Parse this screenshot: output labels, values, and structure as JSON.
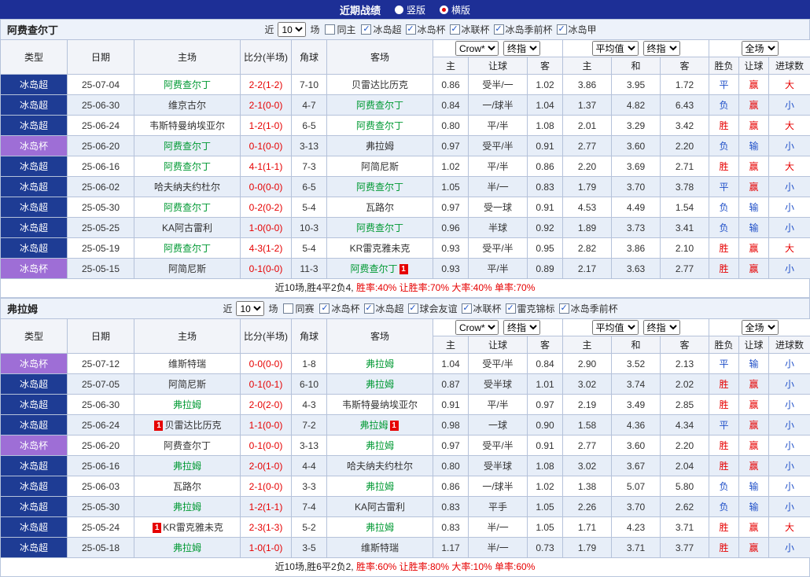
{
  "topbar": {
    "title": "近期战绩",
    "vertical_label": "竖版",
    "horizontal_label": "横版",
    "selected": "横版"
  },
  "labels": {
    "near": "近",
    "games": "场"
  },
  "badge_label": "1",
  "checkmark": "✓",
  "table_headers": [
    "类型",
    "日期",
    "主场",
    "比分(半场)",
    "角球",
    "客场",
    "主",
    "让球",
    "客",
    "主",
    "和",
    "客",
    "胜负",
    "让球",
    "进球数"
  ],
  "group_dropdowns": [
    [
      "Crow*",
      "终指"
    ],
    [
      "平均值",
      "终指"
    ],
    [
      "全场"
    ]
  ],
  "colors": {
    "topbar_bg": "#1d2f96",
    "league_super_bg": "#1e3c94",
    "league_cup_bg": "#9e6ed6",
    "focus_green": "#009933",
    "score_red": "#e60000",
    "win_red": "#e60000",
    "lose_blue": "#2050c8",
    "alt_row_bg": "#e7eef8",
    "badge_red": "#e60000"
  },
  "sections": [
    {
      "team": "阿费查尔丁",
      "count": "10",
      "same_label": "同主",
      "leagues": [
        "冰岛超",
        "冰岛杯",
        "冰联杯",
        "冰岛季前杯",
        "冰岛甲"
      ],
      "rows": [
        {
          "league": "冰岛超",
          "date": "25-07-04",
          "home": "阿费查尔丁",
          "home_focus": true,
          "score": "2-2(1-2)",
          "corners": "7-10",
          "away": "贝雷达比历克",
          "away_focus": false,
          "odds_home": "0.86",
          "handicap": "受半/一",
          "odds_away": "1.02",
          "avg_home": "3.86",
          "avg_draw": "3.95",
          "avg_away": "1.72",
          "result": "平",
          "handicap_result": "赢",
          "goals": "大"
        },
        {
          "league": "冰岛超",
          "date": "25-06-30",
          "home": "维京古尔",
          "home_focus": false,
          "score": "2-1(0-0)",
          "corners": "4-7",
          "away": "阿费查尔丁",
          "away_focus": true,
          "odds_home": "0.84",
          "handicap": "一/球半",
          "odds_away": "1.04",
          "avg_home": "1.37",
          "avg_draw": "4.82",
          "avg_away": "6.43",
          "result": "负",
          "handicap_result": "赢",
          "goals": "小"
        },
        {
          "league": "冰岛超",
          "date": "25-06-24",
          "home": "韦斯特曼纳埃亚尔",
          "home_focus": false,
          "score": "1-2(1-0)",
          "corners": "6-5",
          "away": "阿费查尔丁",
          "away_focus": true,
          "odds_home": "0.80",
          "handicap": "平/半",
          "odds_away": "1.08",
          "avg_home": "2.01",
          "avg_draw": "3.29",
          "avg_away": "3.42",
          "result": "胜",
          "handicap_result": "赢",
          "goals": "大"
        },
        {
          "league": "冰岛杯",
          "is_cup": true,
          "date": "25-06-20",
          "home": "阿费查尔丁",
          "home_focus": true,
          "score": "0-1(0-0)",
          "corners": "3-13",
          "away": "弗拉姆",
          "away_focus": false,
          "odds_home": "0.97",
          "handicap": "受平/半",
          "odds_away": "0.91",
          "avg_home": "2.77",
          "avg_draw": "3.60",
          "avg_away": "2.20",
          "result": "负",
          "handicap_result": "输",
          "goals": "小"
        },
        {
          "league": "冰岛超",
          "date": "25-06-16",
          "home": "阿费查尔丁",
          "home_focus": true,
          "score": "4-1(1-1)",
          "corners": "7-3",
          "away": "阿简尼斯",
          "away_focus": false,
          "odds_home": "1.02",
          "handicap": "平/半",
          "odds_away": "0.86",
          "avg_home": "2.20",
          "avg_draw": "3.69",
          "avg_away": "2.71",
          "result": "胜",
          "handicap_result": "赢",
          "goals": "大"
        },
        {
          "league": "冰岛超",
          "date": "25-06-02",
          "home": "哈夫纳夫约杜尔",
          "home_focus": false,
          "score": "0-0(0-0)",
          "corners": "6-5",
          "away": "阿费查尔丁",
          "away_focus": true,
          "odds_home": "1.05",
          "handicap": "半/一",
          "odds_away": "0.83",
          "avg_home": "1.79",
          "avg_draw": "3.70",
          "avg_away": "3.78",
          "result": "平",
          "handicap_result": "赢",
          "goals": "小"
        },
        {
          "league": "冰岛超",
          "date": "25-05-30",
          "home": "阿费查尔丁",
          "home_focus": true,
          "score": "0-2(0-2)",
          "corners": "5-4",
          "away": "瓦路尔",
          "away_focus": false,
          "odds_home": "0.97",
          "handicap": "受一球",
          "odds_away": "0.91",
          "avg_home": "4.53",
          "avg_draw": "4.49",
          "avg_away": "1.54",
          "result": "负",
          "handicap_result": "输",
          "goals": "小"
        },
        {
          "league": "冰岛超",
          "date": "25-05-25",
          "home": "KA阿古雷利",
          "home_focus": false,
          "score": "1-0(0-0)",
          "corners": "10-3",
          "away": "阿费查尔丁",
          "away_focus": true,
          "odds_home": "0.96",
          "handicap": "半球",
          "odds_away": "0.92",
          "avg_home": "1.89",
          "avg_draw": "3.73",
          "avg_away": "3.41",
          "result": "负",
          "handicap_result": "输",
          "goals": "小"
        },
        {
          "league": "冰岛超",
          "date": "25-05-19",
          "home": "阿费查尔丁",
          "home_focus": true,
          "score": "4-3(1-2)",
          "corners": "5-4",
          "away": "KR雷克雅未克",
          "away_focus": false,
          "odds_home": "0.93",
          "handicap": "受平/半",
          "odds_away": "0.95",
          "avg_home": "2.82",
          "avg_draw": "3.86",
          "avg_away": "2.10",
          "result": "胜",
          "handicap_result": "赢",
          "goals": "大"
        },
        {
          "league": "冰岛杯",
          "is_cup": true,
          "date": "25-05-15",
          "home": "阿简尼斯",
          "home_focus": false,
          "score": "0-1(0-0)",
          "corners": "11-3",
          "away": "阿费查尔丁",
          "away_focus": true,
          "away_red_card": true,
          "odds_home": "0.93",
          "handicap": "平/半",
          "odds_away": "0.89",
          "avg_home": "2.17",
          "avg_draw": "3.63",
          "avg_away": "2.77",
          "result": "胜",
          "handicap_result": "赢",
          "goals": "小"
        }
      ],
      "summary_prefix": "近10场,胜4平2负4, ",
      "summary_stats": "胜率:40% 让胜率:70% 大率:40% 单率:70%"
    },
    {
      "team": "弗拉姆",
      "count": "10",
      "same_label": "同赛",
      "leagues": [
        "冰岛杯",
        "冰岛超",
        "球会友谊",
        "冰联杯",
        "雷克锦标",
        "冰岛季前杯"
      ],
      "rows": [
        {
          "league": "冰岛杯",
          "is_cup": true,
          "date": "25-07-12",
          "home": "维斯特瑞",
          "home_focus": false,
          "score": "0-0(0-0)",
          "corners": "1-8",
          "away": "弗拉姆",
          "away_focus": true,
          "odds_home": "1.04",
          "handicap": "受平/半",
          "odds_away": "0.84",
          "avg_home": "2.90",
          "avg_draw": "3.52",
          "avg_away": "2.13",
          "result": "平",
          "handicap_result": "输",
          "goals": "小"
        },
        {
          "league": "冰岛超",
          "date": "25-07-05",
          "home": "阿简尼斯",
          "home_focus": false,
          "score": "0-1(0-1)",
          "corners": "6-10",
          "away": "弗拉姆",
          "away_focus": true,
          "odds_home": "0.87",
          "handicap": "受半球",
          "odds_away": "1.01",
          "avg_home": "3.02",
          "avg_draw": "3.74",
          "avg_away": "2.02",
          "result": "胜",
          "handicap_result": "赢",
          "goals": "小"
        },
        {
          "league": "冰岛超",
          "date": "25-06-30",
          "home": "弗拉姆",
          "home_focus": true,
          "score": "2-0(2-0)",
          "corners": "4-3",
          "away": "韦斯特曼纳埃亚尔",
          "away_focus": false,
          "odds_home": "0.91",
          "handicap": "平/半",
          "odds_away": "0.97",
          "avg_home": "2.19",
          "avg_draw": "3.49",
          "avg_away": "2.85",
          "result": "胜",
          "handicap_result": "赢",
          "goals": "小"
        },
        {
          "league": "冰岛超",
          "date": "25-06-24",
          "home": "贝雷达比历克",
          "home_focus": false,
          "home_red_card": true,
          "score": "1-1(0-0)",
          "corners": "7-2",
          "away": "弗拉姆",
          "away_focus": true,
          "away_red_card": true,
          "odds_home": "0.98",
          "handicap": "一球",
          "odds_away": "0.90",
          "avg_home": "1.58",
          "avg_draw": "4.36",
          "avg_away": "4.34",
          "result": "平",
          "handicap_result": "赢",
          "goals": "小"
        },
        {
          "league": "冰岛杯",
          "is_cup": true,
          "date": "25-06-20",
          "home": "阿费查尔丁",
          "home_focus": false,
          "score": "0-1(0-0)",
          "corners": "3-13",
          "away": "弗拉姆",
          "away_focus": true,
          "odds_home": "0.97",
          "handicap": "受平/半",
          "odds_away": "0.91",
          "avg_home": "2.77",
          "avg_draw": "3.60",
          "avg_away": "2.20",
          "result": "胜",
          "handicap_result": "赢",
          "goals": "小"
        },
        {
          "league": "冰岛超",
          "date": "25-06-16",
          "home": "弗拉姆",
          "home_focus": true,
          "score": "2-0(1-0)",
          "corners": "4-4",
          "away": "哈夫纳夫约杜尔",
          "away_focus": false,
          "odds_home": "0.80",
          "handicap": "受半球",
          "odds_away": "1.08",
          "avg_home": "3.02",
          "avg_draw": "3.67",
          "avg_away": "2.04",
          "result": "胜",
          "handicap_result": "赢",
          "goals": "小"
        },
        {
          "league": "冰岛超",
          "date": "25-06-03",
          "home": "瓦路尔",
          "home_focus": false,
          "score": "2-1(0-0)",
          "corners": "3-3",
          "away": "弗拉姆",
          "away_focus": true,
          "odds_home": "0.86",
          "handicap": "一/球半",
          "odds_away": "1.02",
          "avg_home": "1.38",
          "avg_draw": "5.07",
          "avg_away": "5.80",
          "result": "负",
          "handicap_result": "输",
          "goals": "小"
        },
        {
          "league": "冰岛超",
          "date": "25-05-30",
          "home": "弗拉姆",
          "home_focus": true,
          "score": "1-2(1-1)",
          "corners": "7-4",
          "away": "KA阿古雷利",
          "away_focus": false,
          "odds_home": "0.83",
          "handicap": "平手",
          "odds_away": "1.05",
          "avg_home": "2.26",
          "avg_draw": "3.70",
          "avg_away": "2.62",
          "result": "负",
          "handicap_result": "输",
          "goals": "小"
        },
        {
          "league": "冰岛超",
          "date": "25-05-24",
          "home": "KR雷克雅未克",
          "home_focus": false,
          "home_red_card": true,
          "score": "2-3(1-3)",
          "corners": "5-2",
          "away": "弗拉姆",
          "away_focus": true,
          "odds_home": "0.83",
          "handicap": "半/一",
          "odds_away": "1.05",
          "avg_home": "1.71",
          "avg_draw": "4.23",
          "avg_away": "3.71",
          "result": "胜",
          "handicap_result": "赢",
          "goals": "大"
        },
        {
          "league": "冰岛超",
          "date": "25-05-18",
          "home": "弗拉姆",
          "home_focus": true,
          "score": "1-0(1-0)",
          "corners": "3-5",
          "away": "维斯特瑞",
          "away_focus": false,
          "odds_home": "1.17",
          "handicap": "半/一",
          "odds_away": "0.73",
          "avg_home": "1.79",
          "avg_draw": "3.71",
          "avg_away": "3.77",
          "result": "胜",
          "handicap_result": "赢",
          "goals": "小"
        }
      ],
      "summary_prefix": "近10场,胜6平2负2, ",
      "summary_stats": "胜率:60% 让胜率:80% 大率:10% 单率:60%"
    }
  ]
}
